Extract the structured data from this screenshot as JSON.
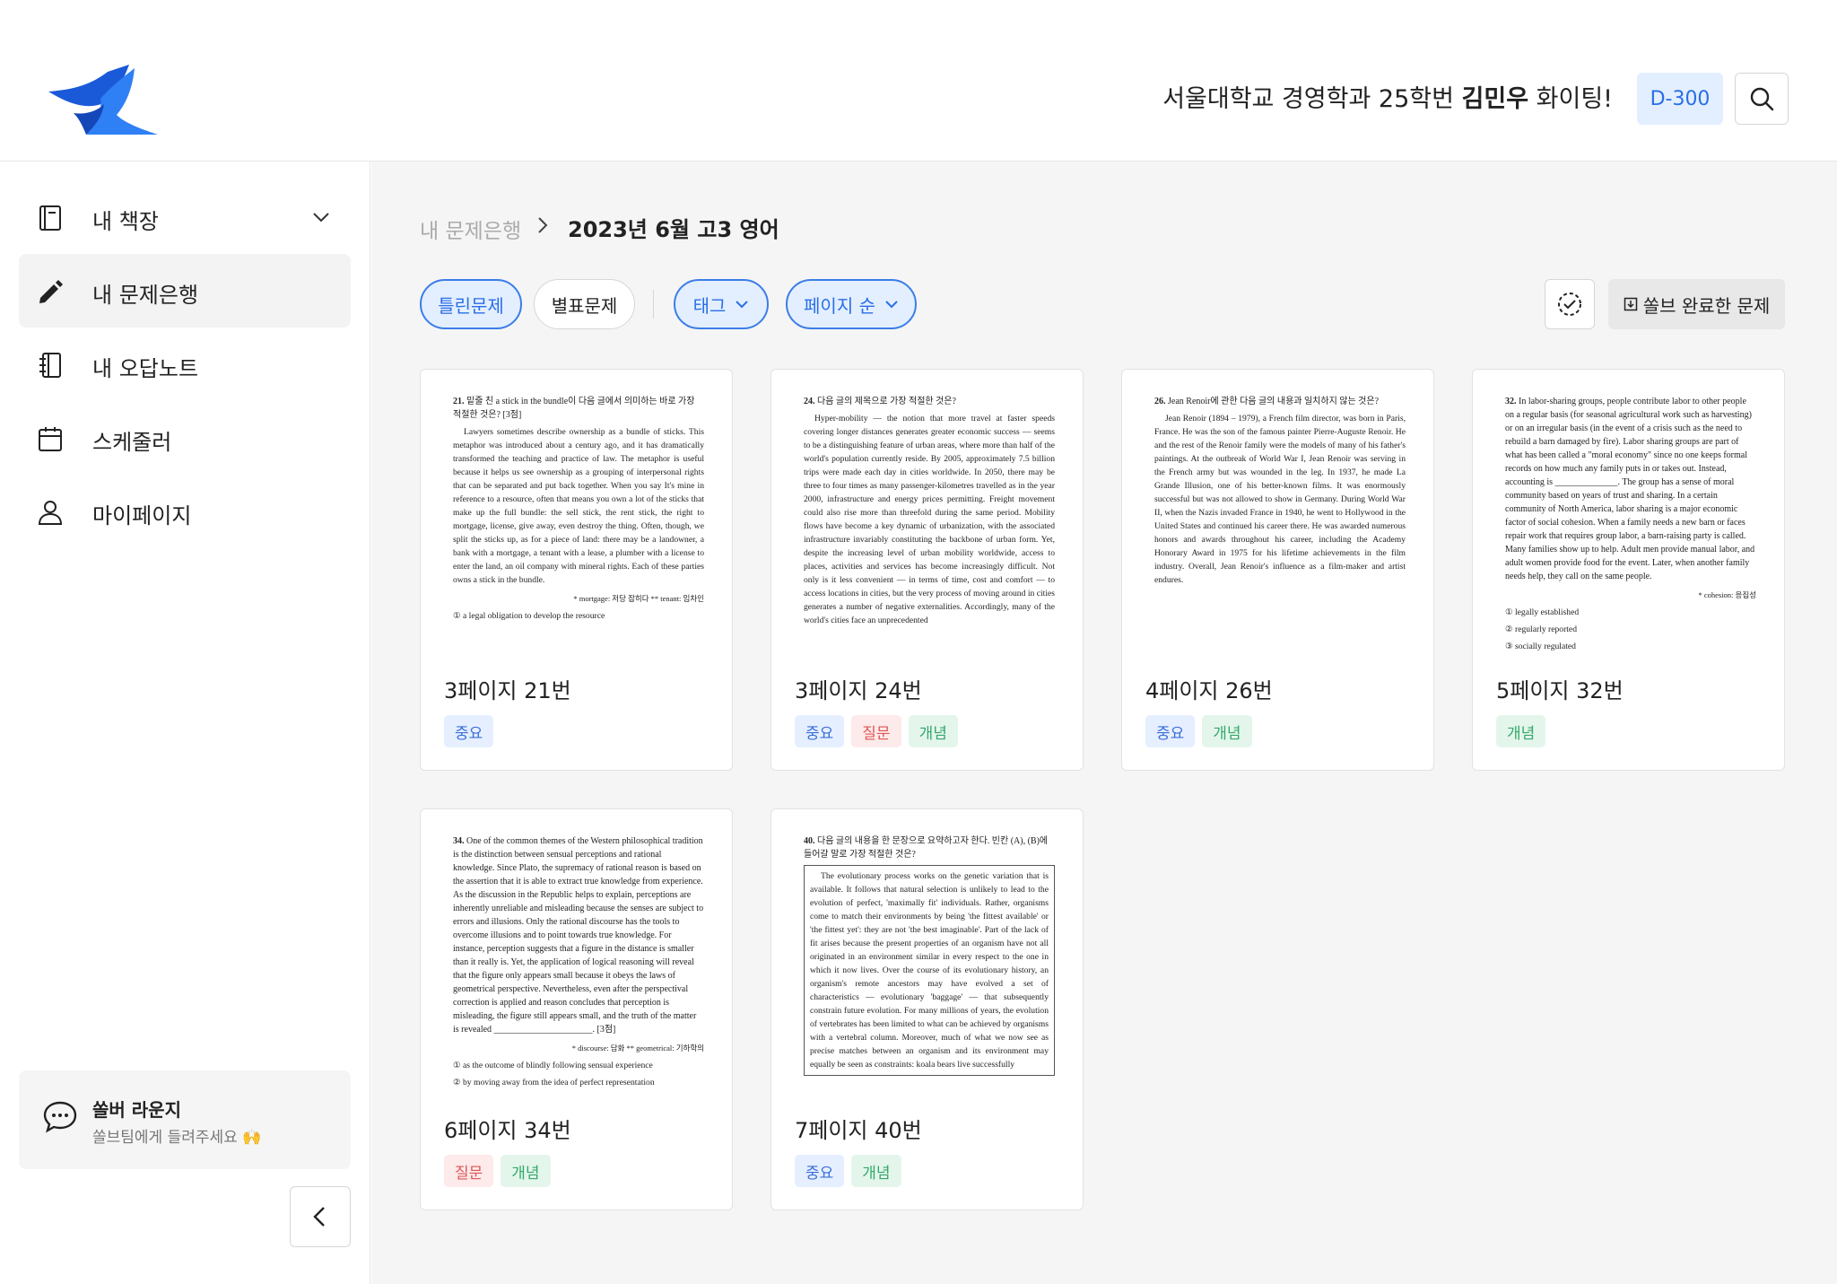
{
  "header": {
    "greeting_prefix": "서울대학교 경영학과 25학번 ",
    "user_name": "김민우",
    "greeting_suffix": " 화이팅!",
    "dday": "D-300",
    "accent": "#2a6ee8"
  },
  "sidebar": {
    "items": [
      {
        "label": "내 책장",
        "icon": "notebook-icon"
      },
      {
        "label": "내 문제은행",
        "icon": "pencil-icon"
      },
      {
        "label": "내 오답노트",
        "icon": "spiral-notebook-icon"
      },
      {
        "label": "스케줄러",
        "icon": "calendar-icon"
      },
      {
        "label": "마이페이지",
        "icon": "user-icon"
      }
    ],
    "lounge": {
      "title": "쏠버 라운지",
      "subtitle": "쏠브팀에게 들려주세요 🙌"
    }
  },
  "breadcrumb": {
    "root": "내 문제은행",
    "current": "2023년 6월 고3 영어"
  },
  "filters": {
    "wrong": "틀린문제",
    "starred": "별표문제",
    "tag": "태그",
    "sort": "페이지 순",
    "solved": "쏠브 완료한 문제"
  },
  "cards": [
    {
      "title": "3페이지 21번",
      "tags": [
        {
          "label": "중요",
          "type": "important"
        }
      ],
      "excerpt": {
        "num": "21.",
        "question": "밑줄 친 a stick in the bundle이 다음 글에서 의미하는 바로 가장 적절한 것은? [3점]",
        "body": "Lawyers sometimes describe ownership as a bundle of sticks. This metaphor was introduced about a century ago, and it has dramatically transformed the teaching and practice of law. The metaphor is useful because it helps us see ownership as a grouping of interpersonal rights that can be separated and put back together. When you say It's mine in reference to a resource, often that means you own a lot of the sticks that make up the full bundle: the sell stick, the rent stick, the right to mortgage, license, give away, even destroy the thing. Often, though, we split the sticks up, as for a piece of land: there may be a landowner, a bank with a mortgage, a tenant with a lease, a plumber with a license to enter the land, an oil company with mineral rights. Each of these parties owns a stick in the bundle.",
        "note": "* mortgage: 저당 잡히다   ** tenant: 임차인",
        "options": [
          "① a legal obligation to develop the resource"
        ]
      }
    },
    {
      "title": "3페이지 24번",
      "tags": [
        {
          "label": "중요",
          "type": "important"
        },
        {
          "label": "질문",
          "type": "question"
        },
        {
          "label": "개념",
          "type": "concept"
        }
      ],
      "excerpt": {
        "num": "24.",
        "question": "다음 글의 제목으로 가장 적절한 것은?",
        "body": "Hyper-mobility — the notion that more travel at faster speeds covering longer distances generates greater economic success — seems to be a distinguishing feature of urban areas, where more than half of the world's population currently reside. By 2005, approximately 7.5 billion trips were made each day in cities worldwide. In 2050, there may be three to four times as many passenger-kilometres travelled as in the year 2000, infrastructure and energy prices permitting. Freight movement could also rise more than threefold during the same period. Mobility flows have become a key dynamic of urbanization, with the associated infrastructure invariably constituting the backbone of urban form. Yet, despite the increasing level of urban mobility worldwide, access to places, activities and services has become increasingly difficult. Not only is it less convenient — in terms of time, cost and comfort — to access locations in cities, but the very process of moving around in cities generates a number of negative externalities. Accordingly, many of the world's cities face an unprecedented",
        "note": "",
        "options": []
      }
    },
    {
      "title": "4페이지 26번",
      "tags": [
        {
          "label": "중요",
          "type": "important"
        },
        {
          "label": "개념",
          "type": "concept"
        }
      ],
      "excerpt": {
        "num": "26.",
        "question": "Jean Renoir에 관한 다음 글의 내용과 일치하지 않는 것은?",
        "body": "Jean Renoir (1894 – 1979), a French film director, was born in Paris, France. He was the son of the famous painter Pierre-Auguste Renoir. He and the rest of the Renoir family were the models of many of his father's paintings. At the outbreak of World War I, Jean Renoir was serving in the French army but was wounded in the leg. In 1937, he made La Grande Illusion, one of his better-known films. It was enormously successful but was not allowed to show in Germany. During World War II, when the Nazis invaded France in 1940, he went to Hollywood in the United States and continued his career there. He was awarded numerous honors and awards throughout his career, including the Academy Honorary Award in 1975 for his lifetime achievements in the film industry. Overall, Jean Renoir's influence as a film-maker and artist endures.",
        "note": "",
        "options": []
      }
    },
    {
      "title": "5페이지 32번",
      "tags": [
        {
          "label": "개념",
          "type": "concept"
        }
      ],
      "excerpt": {
        "num": "32.",
        "question": "",
        "body": "In labor-sharing groups, people contribute labor to other people on a regular basis (for seasonal agricultural work such as harvesting) or on an irregular basis (in the event of a crisis such as the need to rebuild a barn damaged by fire). Labor sharing groups are part of what has been called a \"moral economy\" since no one keeps formal records on how much any family puts in or takes out. Instead, accounting is ______________. The group has a sense of moral community based on years of trust and sharing. In a certain community of North America, labor sharing is a major economic factor of social cohesion. When a family needs a new barn or faces repair work that requires group labor, a barn-raising party is called. Many families show up to help. Adult men provide manual labor, and adult women provide food for the event. Later, when another family needs help, they call on the same people.",
        "note": "* cohesion: 응집성",
        "options": [
          "① legally established",
          "② regularly reported",
          "③ socially regulated"
        ]
      }
    },
    {
      "title": "6페이지 34번",
      "tags": [
        {
          "label": "질문",
          "type": "question"
        },
        {
          "label": "개념",
          "type": "concept"
        }
      ],
      "excerpt": {
        "num": "34.",
        "question": "",
        "body": "One of the common themes of the Western philosophical tradition is the distinction between sensual perceptions and rational knowledge. Since Plato, the supremacy of rational reason is based on the assertion that it is able to extract true knowledge from experience. As the discussion in the Republic helps to explain, perceptions are inherently unreliable and misleading because the senses are subject to errors and illusions. Only the rational discourse has the tools to overcome illusions and to point towards true knowledge. For instance, perception suggests that a figure in the distance is smaller than it really is. Yet, the application of logical reasoning will reveal that the figure only appears small because it obeys the laws of geometrical perspective. Nevertheless, even after the perspectival correction is applied and reason concludes that perception is misleading, the figure still appears small, and the truth of the matter is revealed ______________________. [3점]",
        "note": "* discourse: 담화   ** geometrical: 기하학의",
        "options": [
          "① as the outcome of blindly following sensual experience",
          "② by moving away from the idea of perfect representation"
        ]
      }
    },
    {
      "title": "7페이지 40번",
      "tags": [
        {
          "label": "중요",
          "type": "important"
        },
        {
          "label": "개념",
          "type": "concept"
        }
      ],
      "excerpt": {
        "num": "40.",
        "question": "다음 글의 내용을 한 문장으로 요약하고자 한다. 빈칸 (A), (B)에 들어갈 말로 가장 적절한 것은?",
        "body": "The evolutionary process works on the genetic variation that is available. It follows that natural selection is unlikely to lead to the evolution of perfect, 'maximally fit' individuals. Rather, organisms come to match their environments by being 'the fittest available' or 'the fittest yet': they are not 'the best imaginable'. Part of the lack of fit arises because the present properties of an organism have not all originated in an environment similar in every respect to the one in which it now lives. Over the course of its evolutionary history, an organism's remote ancestors may have evolved a set of characteristics — evolutionary 'baggage' — that subsequently constrain future evolution. For many millions of years, the evolution of vertebrates has been limited to what can be achieved by organisms with a vertebral column. Moreover, much of what we now see as precise matches between an organism and its environment may equally be seen as constraints: koala bears live successfully",
        "note": "",
        "options": []
      }
    }
  ]
}
